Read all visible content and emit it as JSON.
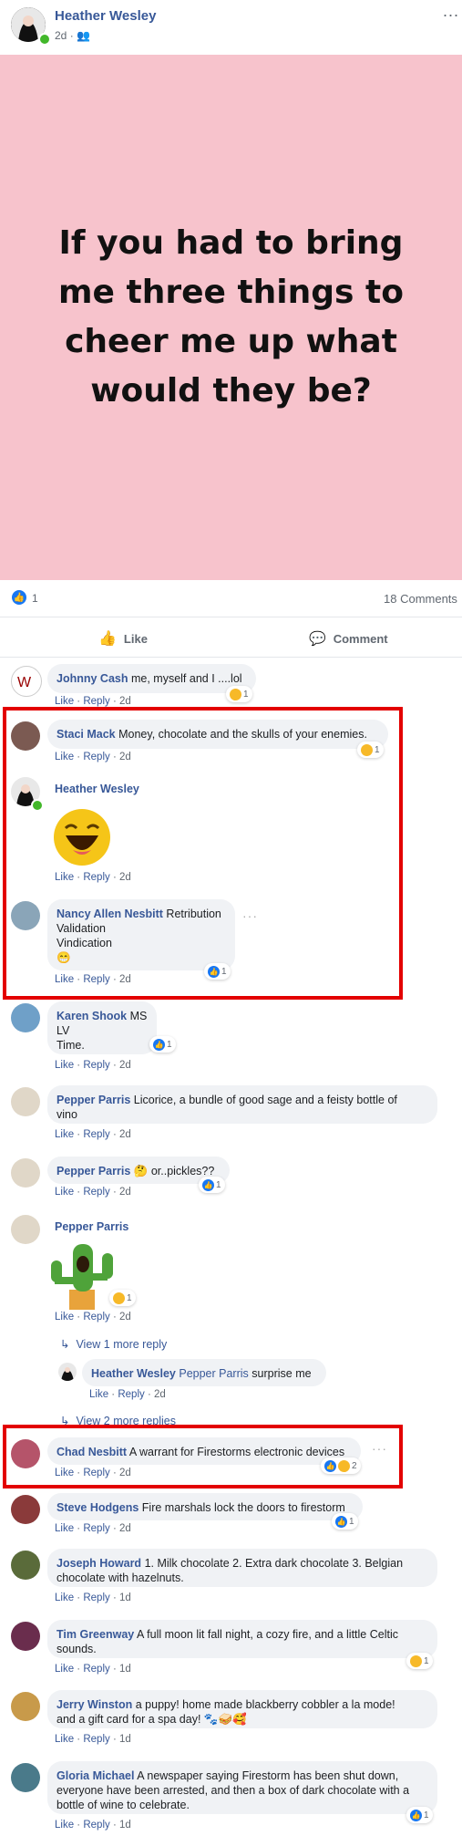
{
  "post": {
    "author": "Heather Wesley",
    "time": "2d",
    "more": "...",
    "text": "If you had to bring me three things to cheer me up what would they be?",
    "like_count": "1",
    "comments_count": "18 Comments",
    "like_label": "Like",
    "comment_label": "Comment"
  },
  "colors": {
    "highlight": "#e30000",
    "background": "#f7c3cc",
    "link": "#385898"
  },
  "footer": {
    "like": "Like",
    "sep": " · ",
    "reply": "Reply"
  },
  "comments": [
    {
      "name": "Johnny Cash",
      "text": "me, myself and I ....lol",
      "time": "2d",
      "react": "1"
    },
    {
      "name": "Staci Mack",
      "text": "Money, chocolate and the skulls of your enemies.",
      "time": "2d",
      "react": "1"
    },
    {
      "name": "Heather Wesley",
      "text": "",
      "time": "2d"
    },
    {
      "name": "Nancy Allen Nesbitt",
      "text": "Retribution",
      "line2": "Validation",
      "line3": "Vindication",
      "line4": "😁",
      "time": "2d",
      "react": "1",
      "more": "···"
    },
    {
      "name": "Karen Shook",
      "text": "MS",
      "line2": "LV",
      "line3": "Time.",
      "time": "2d",
      "react": "1"
    },
    {
      "name": "Pepper Parris",
      "text": "Licorice, a bundle of good sage and a feisty bottle of",
      "line2": "vino",
      "time": "2d"
    },
    {
      "name": "Pepper Parris",
      "text": "🤔 or..pickles??",
      "time": "2d",
      "react": "1"
    },
    {
      "name": "Pepper Parris",
      "text": "",
      "time": "2d",
      "react": "1"
    },
    {
      "name": "Heather Wesley",
      "tag": "Pepper Parris",
      "text": "surprise me",
      "time": "2d"
    },
    {
      "name": "Chad Nesbitt",
      "text": "A warrant for Firestorms electronic devices",
      "time": "2d",
      "react": "2",
      "more": "···"
    },
    {
      "name": "Steve Hodgens",
      "text": "Fire marshals lock the doors to firestorm",
      "time": "2d",
      "react": "1"
    },
    {
      "name": "Joseph Howard",
      "text": "1. Milk chocolate 2. Extra dark chocolate 3. Belgian",
      "line2": "chocolate with hazelnuts.",
      "time": "1d"
    },
    {
      "name": "Tim Greenway",
      "text": "A full moon lit fall night, a cozy fire, and a little Celtic",
      "line2": "sounds.",
      "time": "1d",
      "react": "1"
    },
    {
      "name": "Jerry Winston",
      "text": "a puppy! home made blackberry cobbler a la mode!",
      "line2": "and a gift card for a spa day! 🐾🥪🥰",
      "time": "1d"
    },
    {
      "name": "Gloria Michael",
      "text": "A newspaper saying Firestorm has been shut down,",
      "line2": "everyone have been arrested, and then a box of dark chocolate with a",
      "line3": "bottle of wine to celebrate.",
      "time": "1d",
      "react": "1"
    }
  ],
  "view_more_1": "View 1 more reply",
  "view_more_2": "View 2 more replies"
}
